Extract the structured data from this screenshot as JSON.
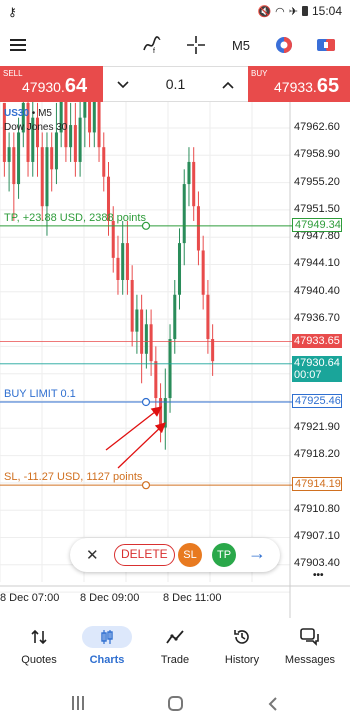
{
  "status": {
    "time": "15:04"
  },
  "toolbar": {
    "timeframe": "M5"
  },
  "trade": {
    "sell_label": "SELL",
    "sell_price_main": "47930.",
    "sell_price_big": "64",
    "buy_label": "BUY",
    "buy_price_main": "47933.",
    "buy_price_big": "65",
    "lot": "0.1",
    "lot_down": "⌄",
    "lot_up": "⌃"
  },
  "chart": {
    "symbol": "US30",
    "timeframe_tag": "M5",
    "name": "Dow Jones 30",
    "y_ticks": [
      "47962.60",
      "47958.90",
      "47955.20",
      "47951.50",
      "47947.80",
      "47944.10",
      "47940.40",
      "47936.70",
      "47921.90",
      "47918.20",
      "47910.80",
      "47907.10",
      "47903.40"
    ],
    "x_ticks": [
      "8 Dec 07:00",
      "8 Dec 09:00",
      "8 Dec 11:00"
    ],
    "tp_label": "TP, +23.88 USD, 2388 points",
    "tp_price": "47949.34",
    "sell_line_price": "47933.65",
    "bid_price": "47930.64",
    "bid_timer": "00:07",
    "buy_limit_label": "BUY LIMIT 0.1",
    "buy_limit_price": "47925.46",
    "sl_label": "SL, -11.27 USD, 1127 points",
    "sl_price": "47914.19",
    "more": "•••",
    "colors": {
      "up": "#2a8c5a",
      "down": "#e84b4b",
      "tp": "#2e9c3a",
      "sl": "#d07020",
      "limit": "#2f6fd0",
      "bid": "#1aa59a"
    }
  },
  "actions": {
    "close": "✕",
    "delete": "DELETE",
    "sl": "SL",
    "tp": "TP",
    "arrow": "→"
  },
  "nav": [
    {
      "label": "Quotes",
      "icon": "quotes-icon"
    },
    {
      "label": "Charts",
      "icon": "charts-icon"
    },
    {
      "label": "Trade",
      "icon": "trade-icon"
    },
    {
      "label": "History",
      "icon": "history-icon"
    },
    {
      "label": "Messages",
      "icon": "messages-icon"
    }
  ],
  "candles": [
    [
      47966,
      47958,
      47966,
      47956
    ],
    [
      47958,
      47960,
      47962,
      47954
    ],
    [
      47960,
      47955,
      47962,
      47950
    ],
    [
      47955,
      47962,
      47964,
      47953
    ],
    [
      47962,
      47966,
      47970,
      47960
    ],
    [
      47966,
      47958,
      47968,
      47956
    ],
    [
      47958,
      47964,
      47968,
      47956
    ],
    [
      47964,
      47960,
      47966,
      47956
    ],
    [
      47960,
      47952,
      47962,
      47950
    ],
    [
      47952,
      47960,
      47962,
      47948
    ],
    [
      47960,
      47957,
      47962,
      47954
    ],
    [
      47957,
      47962,
      47966,
      47955
    ],
    [
      47962,
      47967,
      47970,
      47960
    ],
    [
      47967,
      47960,
      47970,
      47958
    ],
    [
      47960,
      47963,
      47966,
      47958
    ],
    [
      47963,
      47958,
      47966,
      47956
    ],
    [
      47958,
      47964,
      47968,
      47956
    ],
    [
      47964,
      47970,
      47972,
      47960
    ],
    [
      47970,
      47962,
      47972,
      47960
    ],
    [
      47962,
      47968,
      47972,
      47960
    ],
    [
      47968,
      47960,
      47970,
      47958
    ],
    [
      47960,
      47956,
      47962,
      47954
    ],
    [
      47956,
      47950,
      47958,
      47948
    ],
    [
      47950,
      47945,
      47952,
      47943
    ],
    [
      47945,
      47942,
      47948,
      47940
    ],
    [
      47942,
      47947,
      47950,
      47940
    ],
    [
      47947,
      47942,
      47950,
      47940
    ],
    [
      47942,
      47935,
      47944,
      47933
    ],
    [
      47935,
      47938,
      47940,
      47932
    ],
    [
      47938,
      47932,
      47940,
      47928
    ],
    [
      47932,
      47936,
      47938,
      47930
    ],
    [
      47936,
      47931,
      47938,
      47929
    ],
    [
      47931,
      47926,
      47933,
      47924
    ],
    [
      47926,
      47922,
      47928,
      47920
    ],
    [
      47922,
      47926,
      47930,
      47919
    ],
    [
      47926,
      47934,
      47936,
      47924
    ],
    [
      47934,
      47940,
      47942,
      47932
    ],
    [
      47940,
      47947,
      47949,
      47938
    ],
    [
      47947,
      47955,
      47957,
      47944
    ],
    [
      47955,
      47958,
      47960,
      47952
    ],
    [
      47958,
      47952,
      47960,
      47950
    ],
    [
      47952,
      47946,
      47954,
      47944
    ],
    [
      47946,
      47940,
      47948,
      47938
    ],
    [
      47940,
      47934,
      47942,
      47932
    ],
    [
      47934,
      47931,
      47936,
      47929
    ]
  ]
}
